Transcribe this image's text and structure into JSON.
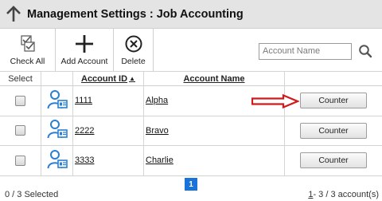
{
  "header": {
    "title": "Management Settings : Job Accounting"
  },
  "toolbar": {
    "check_all_label": "Check All",
    "add_account_label": "Add Account",
    "delete_label": "Delete"
  },
  "search": {
    "placeholder": "Account Name",
    "value": ""
  },
  "table": {
    "columns": {
      "select": "Select",
      "account_id": "Account ID",
      "account_name": "Account Name"
    },
    "sort_indicator": "▲",
    "rows": [
      {
        "id": "1111",
        "name": "Alpha",
        "action": "Counter"
      },
      {
        "id": "2222",
        "name": "Bravo",
        "action": "Counter"
      },
      {
        "id": "3333",
        "name": "Charlie",
        "action": "Counter"
      }
    ]
  },
  "pagination": {
    "current_page": "1"
  },
  "footer": {
    "selected": "0 / 3 Selected",
    "range_first": "1",
    "range_rest": " - 3 / 3 account(s)"
  },
  "colors": {
    "header_bg": "#e4e4e4",
    "pager_blue": "#1a73d9",
    "annotation_red": "#d11a1a",
    "user_icon_blue": "#2a7fd4"
  },
  "icons": {
    "back": "up-arrow-icon",
    "check_all": "check-all-icon",
    "add": "plus-icon",
    "delete": "circle-x-icon",
    "search": "search-icon",
    "user": "user-card-icon",
    "annotation": "red-arrow-icon"
  }
}
